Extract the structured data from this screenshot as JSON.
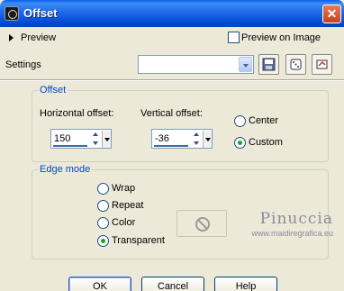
{
  "window": {
    "title": "Offset",
    "close_label": "✕"
  },
  "preview": {
    "label": "Preview",
    "checkbox_label": "Preview on Image",
    "checked": false
  },
  "settings": {
    "label": "Settings",
    "selected_value": ""
  },
  "offset_group": {
    "title": "Offset",
    "horizontal": {
      "label": "Horizontal offset:",
      "value": "150"
    },
    "vertical": {
      "label": "Vertical offset:",
      "value": "-36"
    },
    "options": [
      {
        "label": "Center",
        "checked": false
      },
      {
        "label": "Custom",
        "checked": true
      }
    ]
  },
  "edge_group": {
    "title": "Edge mode",
    "options": [
      {
        "label": "Wrap",
        "checked": false
      },
      {
        "label": "Repeat",
        "checked": false
      },
      {
        "label": "Color",
        "checked": false
      },
      {
        "label": "Transparent",
        "checked": true
      }
    ]
  },
  "watermark": {
    "name": "Pinuccia",
    "url": "www.maidiregrafica.eu"
  },
  "buttons": {
    "ok": "OK",
    "cancel": "Cancel",
    "help": "Help"
  },
  "colors": {
    "titlebar": "#1f6ae8",
    "group_title": "#0046d5",
    "background": "#ece9d8"
  }
}
